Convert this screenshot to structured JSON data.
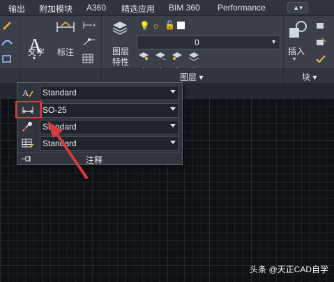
{
  "menubar": {
    "items": [
      "输出",
      "附加模块",
      "A360",
      "精选应用",
      "BIM 360",
      "Performance"
    ],
    "dropdown_symbol": "▲▾"
  },
  "ribbon": {
    "text_label": "文字",
    "dim_label": "标注",
    "layer_props_label_1": "图层",
    "layer_props_label_2": "特性",
    "layer_combo_value": "0",
    "insert_label": "插入"
  },
  "panelbar": {
    "layers_label": "图层 ▾",
    "block_label": "块 ▾"
  },
  "annotation_dropdown": {
    "rows": [
      {
        "icon": "text-style-icon",
        "value": "Standard"
      },
      {
        "icon": "dimension-style-icon",
        "value": "SO-25"
      },
      {
        "icon": "multileader-style-icon",
        "value": "Standard"
      },
      {
        "icon": "table-style-icon",
        "value": "Standard"
      }
    ],
    "footer_label": "注释"
  },
  "watermark": "头条 @天正CAD自学",
  "colors": {
    "highlight": "#e23a3a",
    "arrow": "#d93a3a",
    "ribbon_bg": "#3a3f4a",
    "canvas_bg": "#0f1115"
  }
}
